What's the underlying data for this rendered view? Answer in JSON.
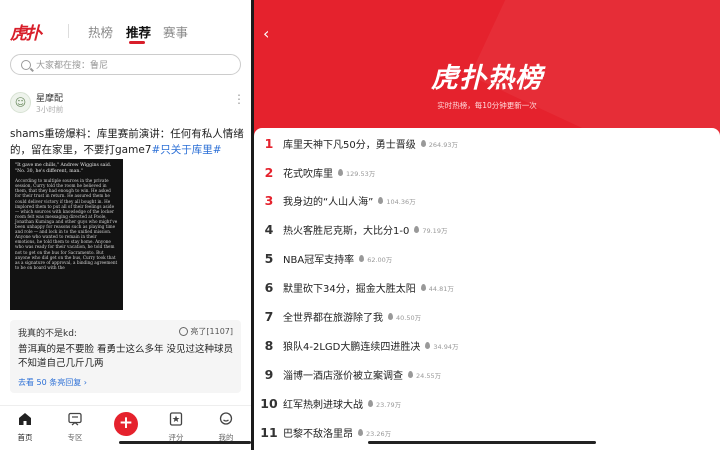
{
  "left": {
    "logo": "虎扑",
    "tabs": [
      {
        "label": "热榜"
      },
      {
        "label": "推荐"
      },
      {
        "label": "赛事"
      }
    ],
    "search_placeholder": "大家都在搜：鲁尼",
    "post": {
      "avatar_text": "☺",
      "username": "星摩配",
      "time": "3小时前",
      "text": "shams重磅爆料：库里赛前演讲：任何有私人情绪的，留在家里，不要打game7",
      "hashtag": "#只关于库里#",
      "image_quote": "\"It gave me chills,\" Andrew Wiggins said. \"No. 30, he's different, man.\"",
      "image_body": "According to multiple sources in the private session, Curry told the room he believed in them, that they had enough to win. He asked for their trust in return. He assured them he could deliver victory if they all bought in. He implored them to put all of their feelings aside — which sources with knowledge of the locker room felt was messaging directed at Poole, Jonathan Kuminga and other guys who might've been unhappy for reasons such as playing time and role — and lock in to the unified mission. Anyone who wanted to remain in their emotions, he told them to stay home. Anyone who was ready for their vacation, he told them not to get on the bus for Sacramento. But anyone who did get on the bus, Curry took that as a signature of approval, a binding agreement to be on board with the"
    },
    "comment": {
      "user": "我真的不是kd:",
      "light": "亮了[1107]",
      "text": "普洱真的是不要脸 看勇士这么多年 没见过这种球员 不知道自己几斤几两",
      "more": "去看 50 条亮回复"
    },
    "nav": [
      {
        "label": "首页",
        "icon": "home-icon"
      },
      {
        "label": "专区",
        "icon": "zone-icon"
      },
      {
        "label": "评分",
        "icon": "rating-icon"
      },
      {
        "label": "我的",
        "icon": "profile-icon"
      }
    ],
    "plus": "+"
  },
  "right": {
    "back": "‹",
    "title": "虎扑热榜",
    "subtitle": "实时热榜，每10分钟更新一次",
    "items": [
      {
        "rank": "1",
        "title": "库里天神下凡50分，勇士晋级",
        "heat": "264.93万"
      },
      {
        "rank": "2",
        "title": "花式吹库里",
        "heat": "129.53万"
      },
      {
        "rank": "3",
        "title": "我身边的“人山人海”",
        "heat": "104.36万"
      },
      {
        "rank": "4",
        "title": "热火客胜尼克斯，大比分1-0",
        "heat": "79.19万"
      },
      {
        "rank": "5",
        "title": "NBA冠军支持率",
        "heat": "62.00万"
      },
      {
        "rank": "6",
        "title": "默里砍下34分，掘金大胜太阳",
        "heat": "44.81万"
      },
      {
        "rank": "7",
        "title": "全世界都在旅游除了我",
        "heat": "40.50万"
      },
      {
        "rank": "8",
        "title": "狼队4-2LGD大鹏连续四进胜决",
        "heat": "34.94万"
      },
      {
        "rank": "9",
        "title": "淄博一酒店涨价被立案调查",
        "heat": "24.55万"
      },
      {
        "rank": "10",
        "title": "红军热刺进球大战",
        "heat": "23.79万"
      },
      {
        "rank": "11",
        "title": "巴黎不敌洛里昂",
        "heat": "23.26万"
      }
    ]
  },
  "colors": {
    "brand_red": "#e5222d",
    "link_blue": "#2b6fd6"
  }
}
